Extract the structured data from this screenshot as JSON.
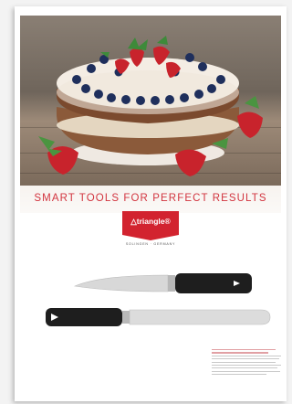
{
  "brochure": {
    "headline": "SMART TOOLS FOR PERFECT RESULTS",
    "brand_logo": "△triangle®",
    "location": "SOLINGEN · GERMANY"
  },
  "product": {
    "title": "",
    "body": ""
  },
  "colors": {
    "accent_red": "#d2232f",
    "headline_red": "#d2343f",
    "handle_black": "#1e1e1e",
    "blade_steel": "#d8d8d8"
  }
}
